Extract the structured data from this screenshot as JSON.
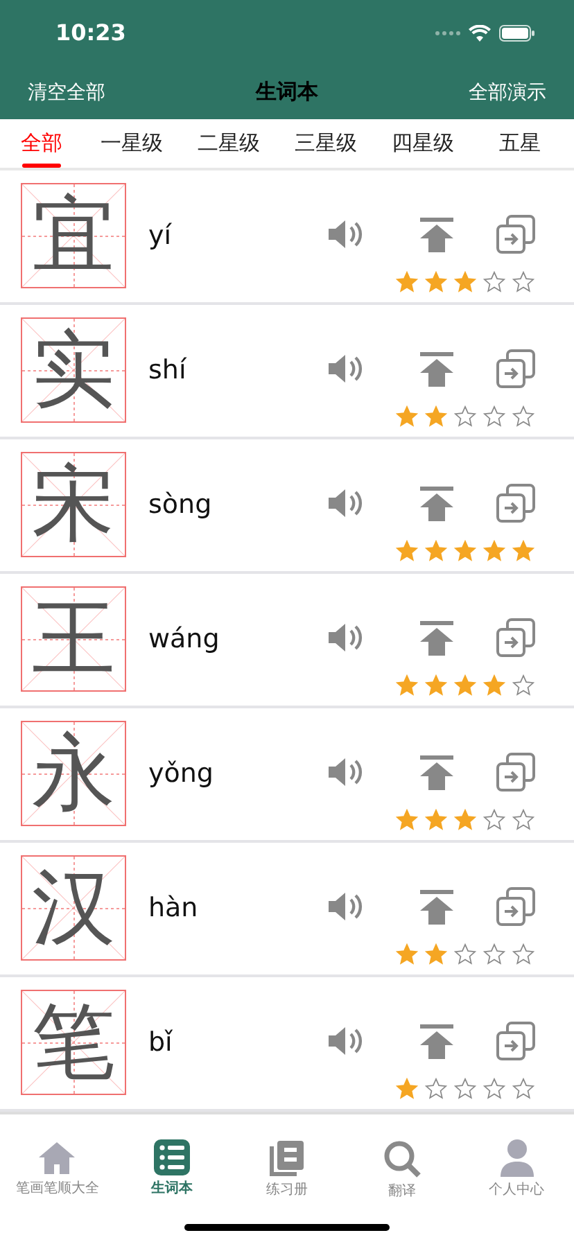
{
  "status_bar": {
    "time": "10:23"
  },
  "header": {
    "left_action": "清空全部",
    "title": "生词本",
    "right_action": "全部演示"
  },
  "tabs": [
    {
      "label": "全部",
      "selected": true
    },
    {
      "label": "一星级",
      "selected": false
    },
    {
      "label": "二星级",
      "selected": false
    },
    {
      "label": "三星级",
      "selected": false
    },
    {
      "label": "四星级",
      "selected": false
    },
    {
      "label": "五星",
      "selected": false
    }
  ],
  "words": [
    {
      "character": "宜",
      "pinyin": "yí",
      "stars": 3
    },
    {
      "character": "实",
      "pinyin": "shí",
      "stars": 2
    },
    {
      "character": "宋",
      "pinyin": "sòng",
      "stars": 5
    },
    {
      "character": "王",
      "pinyin": "wáng",
      "stars": 4
    },
    {
      "character": "永",
      "pinyin": "yǒng",
      "stars": 3
    },
    {
      "character": "汉",
      "pinyin": "hàn",
      "stars": 2
    },
    {
      "character": "笔",
      "pinyin": "bǐ",
      "stars": 1
    }
  ],
  "tab_bar": [
    {
      "label": "笔画笔顺大全",
      "kind": "home",
      "selected": false
    },
    {
      "label": "生词本",
      "kind": "list",
      "selected": true
    },
    {
      "label": "练习册",
      "kind": "book",
      "selected": false
    },
    {
      "label": "翻译",
      "kind": "search",
      "selected": false
    },
    {
      "label": "个人中心",
      "kind": "person",
      "selected": false
    }
  ]
}
